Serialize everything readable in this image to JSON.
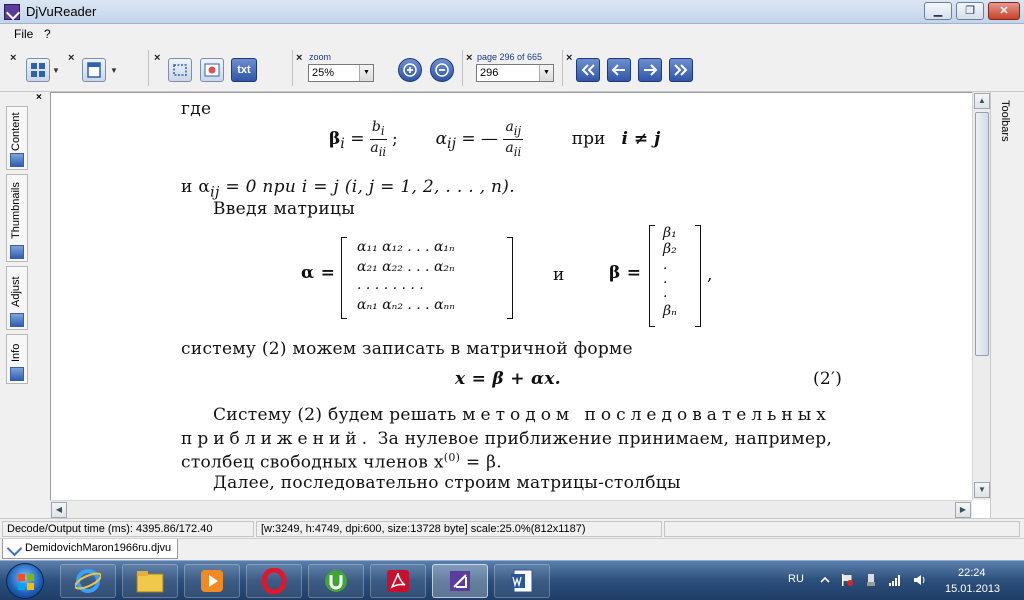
{
  "window": {
    "title": "DjVuReader",
    "min_glyph": "▁",
    "max_glyph": "❐",
    "close_glyph": "✕"
  },
  "menu": [
    "File",
    "?"
  ],
  "toolbar": {
    "close_glyph": "×",
    "zoom_label": "zoom",
    "zoom_value": "25%",
    "page_label": "page 296 of 665",
    "page_value": "296",
    "text_button": "txt"
  },
  "sidebar": {
    "close_glyph": "×",
    "tabs": [
      "Content",
      "Thumbnails",
      "Adjust",
      "Info"
    ]
  },
  "right_panel": {
    "label": "Toolbars"
  },
  "document": {
    "line_gde": "где",
    "eq1_beta": "β",
    "eq1_sub_i": "i",
    "eq1_num": "b",
    "eq1_num_sub": "i",
    "eq1_den": "a",
    "eq1_den_sub": "ii",
    "eq1_alpha": "α",
    "eq1_alpha_sub": "ij",
    "eq1_rnum": "a",
    "eq1_rnum_sub": "ij",
    "eq1_rden": "a",
    "eq1_rden_sub": "ii",
    "eq1_pri": "при",
    "eq1_cond": "i ≠ j",
    "line_and": "и  α",
    "line_and_sub": "ij",
    "line_and_rest": " = 0  при  i = j   (i, j = 1,  2,  . . . , n).",
    "line_vvedya": "Введя матрицы",
    "matrix_alpha_label": "α =",
    "matrix_alpha_rows": [
      "α₁₁    α₁₂ . . . α₁ₙ",
      "α₂₁    α₂₂ . . . α₂ₙ",
      "  .  .  .  .  .  .  .  .",
      "αₙ₁    αₙ₂ . . . αₙₙ"
    ],
    "matrix_and": "и",
    "matrix_beta_label": "β =",
    "matrix_beta_rows": [
      "β₁",
      "β₂",
      " .",
      " .",
      " .",
      "βₙ"
    ],
    "matrix_comma": ",",
    "line_sistemu": "систему (2) можем записать в матричной форме",
    "eq2": "x = β + αx.",
    "eq2_num": "(2′)",
    "para1": "Систему (2) будем решать",
    "para1_spaced": "методом последовательных",
    "para2_spaced": "приближений.",
    "para2": "За нулевое приближение принимаем,  например,",
    "para3": "столбец свободных членов  x",
    "para3_sup": "(0)",
    "para3_end": " = β.",
    "para4": "Далее, последовательно строим матрицы-столбцы"
  },
  "status": {
    "decode": "Decode/Output time (ms): 4395.86/172.40",
    "info": "[w:3249, h:4749, dpi:600, size:13728 byte] scale:25.0%(812x1187)"
  },
  "doc_tab": {
    "label": "DemidovichMaron1966ru.djvu"
  },
  "taskbar": {
    "apps": [
      "internet-explorer",
      "file-explorer",
      "media-player",
      "opera",
      "utorrent",
      "acrobat",
      "djvureader",
      "word"
    ],
    "lang": "RU",
    "time": "22:24",
    "date": "15.01.2013"
  },
  "colors": {
    "accent": "#2f56a8",
    "taskbar": "#2c4f7c"
  }
}
